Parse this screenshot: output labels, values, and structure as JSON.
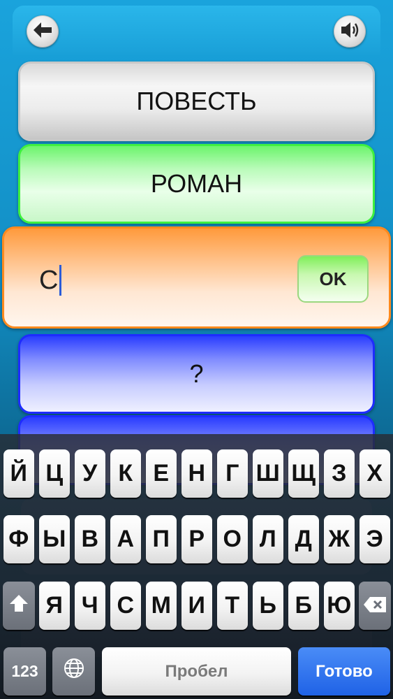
{
  "header": {
    "back_icon": "arrow-left-icon",
    "sound_icon": "speaker-icon"
  },
  "cards": {
    "option1": "ПОВЕСТЬ",
    "option2": "РОМАН",
    "option3": "?"
  },
  "answer": {
    "value": "С",
    "ok_label": "OK"
  },
  "keyboard": {
    "row1": [
      "Й",
      "Ц",
      "У",
      "К",
      "Е",
      "Н",
      "Г",
      "Ш",
      "Щ",
      "З",
      "Х"
    ],
    "row2": [
      "Ф",
      "Ы",
      "В",
      "А",
      "П",
      "Р",
      "О",
      "Л",
      "Д",
      "Ж",
      "Э"
    ],
    "row3": [
      "Я",
      "Ч",
      "С",
      "М",
      "И",
      "Т",
      "Ь",
      "Б",
      "Ю"
    ],
    "shift_icon": "shift-arrow-icon",
    "backspace_icon": "backspace-icon",
    "numbers_label": "123",
    "globe_icon": "globe-icon",
    "space_label": "Пробел",
    "done_label": "Готово"
  },
  "colors": {
    "accent_orange": "#ff8a1e",
    "correct_green": "#3ff03f",
    "pending_blue": "#1e2cff",
    "done_blue": "#1f62e6"
  }
}
